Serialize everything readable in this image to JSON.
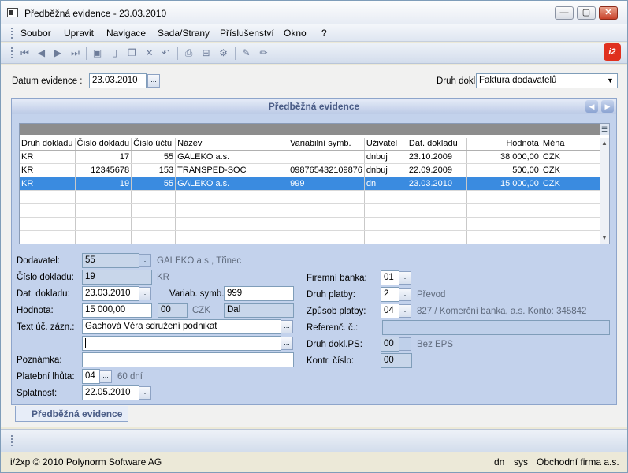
{
  "window": {
    "title": "Předběžná evidence - 23.03.2010",
    "min_label": "—",
    "max_label": "▢",
    "close_label": "✕"
  },
  "menu": [
    "Soubor",
    "Upravit",
    "Navigace",
    "Sada/Strany",
    "Příslušenství",
    "Okno",
    "?"
  ],
  "toolbar": {
    "logo_text": "i2"
  },
  "header": {
    "datum_label": "Datum evidence :",
    "datum_value": "23.03.2010",
    "druh_label": "Druh dokl.",
    "druh_value": "Faktura dodavatelů",
    "ellipsis": "..."
  },
  "panel": {
    "title": "Předběžná evidence"
  },
  "grid": {
    "columns": [
      "Druh dokladu",
      "Číslo dokladu",
      "Číslo účtu",
      "Název",
      "Variabilní symb.",
      "Uživatel",
      "Dat. dokladu",
      "Hodnota",
      "Měna"
    ],
    "rows": [
      [
        "KR",
        "17",
        "55",
        "GALEKO a.s.",
        "",
        "dnbuj",
        "23.10.2009",
        "38 000,00",
        "CZK"
      ],
      [
        "KR",
        "12345678",
        "153",
        "TRANSPED-SOC",
        "098765432109876",
        "dnbuj",
        "22.09.2009",
        "500,00",
        "CZK"
      ],
      [
        "KR",
        "19",
        "55",
        "GALEKO a.s.",
        "999",
        "dn",
        "23.03.2010",
        "15 000,00",
        "CZK"
      ]
    ],
    "selected_row": 2
  },
  "form": {
    "dodavatel_label": "Dodavatel:",
    "dodavatel_value": "55",
    "dodavatel_name": "GALEKO a.s., Třinec",
    "cislo_label": "Číslo dokladu:",
    "cislo_value": "19",
    "cislo_suffix": "KR",
    "dat_label": "Dat. dokladu:",
    "dat_value": "23.03.2010",
    "variab_label": "Variab. symb.:",
    "variab_value": "999",
    "hodnota_label": "Hodnota:",
    "hodnota_value": "15 000,00",
    "hodnota_code": "00",
    "hodnota_currency": "CZK",
    "hodnota_side": "Dal",
    "text_label": "Text úč. zázn.:",
    "text_value": "Gachová Věra sdružení podnikat",
    "text_value2": "",
    "poznamka_label": "Poznámka:",
    "poznamka_value": "",
    "lhuta_label": "Platební lhůta:",
    "lhuta_value": "04",
    "lhuta_text": "60 dní",
    "splatnost_label": "Splatnost:",
    "splatnost_value": "22.05.2010",
    "banka_label": "Firemní banka:",
    "banka_value": "01",
    "platby_label": "Druh platby:",
    "platby_value": "2",
    "platby_text": "Převod",
    "zpusob_label": "Způsob platby:",
    "zpusob_value": "04",
    "zpusob_text": "827 /  Komerční banka, a.s. Konto: 345842",
    "referenc_label": "Referenč. č.:",
    "referenc_value": "",
    "druhps_label": "Druh dokl.PS:",
    "druhps_value": "00",
    "druhps_text": "Bez EPS",
    "kontr_label": "Kontr. číslo:",
    "kontr_value": "00"
  },
  "tabs": {
    "bottom_tab": "Předběžná evidence"
  },
  "status": {
    "copyright": "i/2xp © 2010 Polynorm Software AG",
    "user": "dn",
    "sys": "sys",
    "firm": "Obchodní firma a.s."
  }
}
